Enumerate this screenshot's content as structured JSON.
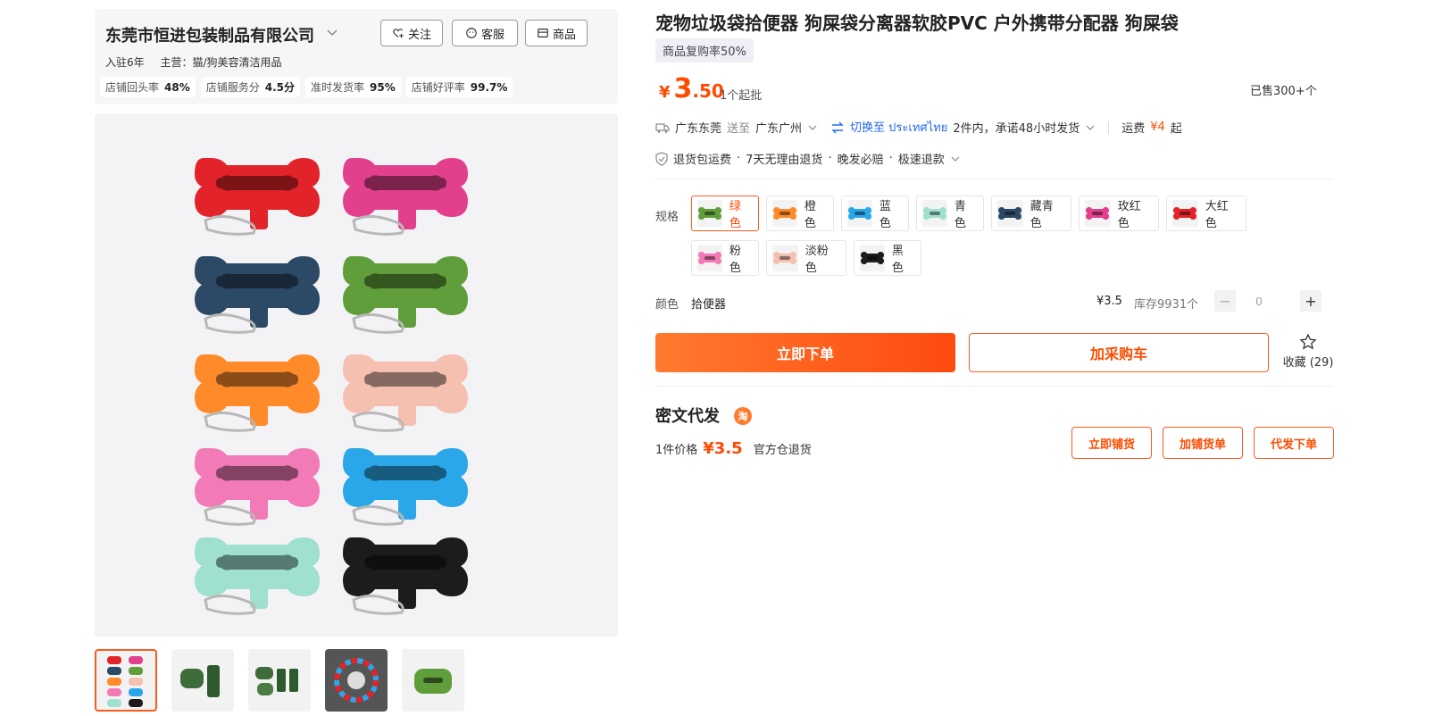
{
  "shop": {
    "name": "东莞市恒进包装制品有限公司",
    "follow_label": "关注",
    "service_label": "客服",
    "goods_label": "商品",
    "years": "入驻6年",
    "main_business": "主营：猫/狗美容清洁用品",
    "stats": [
      {
        "label": "店铺回头率",
        "value": "48%"
      },
      {
        "label": "店铺服务分",
        "value": "4.5分"
      },
      {
        "label": "准时发货率",
        "value": "95%"
      },
      {
        "label": "店铺好评率",
        "value": "99.7%"
      }
    ]
  },
  "product": {
    "title": "宠物垃圾袋拾便器 狗屎袋分离器软胶PVC 户外携带分配器 狗屎袋",
    "repurchase": "商品复购率50%",
    "price_currency": "¥",
    "price_int": "3",
    "price_dec": ".50",
    "min_order": "1个起批",
    "sold": "已售300+个"
  },
  "shipping": {
    "from": "广东东莞",
    "to_word": "送至",
    "to": "广东广州",
    "switch": "切换至 ประเทศไทย",
    "promise": "2件内，承诺48小时发货",
    "fee_label": "运费",
    "fee": "¥4",
    "fee_suffix": "起"
  },
  "services": [
    "退货包运费",
    "7天无理由退货",
    "晚发必赔",
    "极速退款"
  ],
  "spec": {
    "label": "规格",
    "options": [
      {
        "label": "绿色",
        "color": "#5f9e3a",
        "selected": true
      },
      {
        "label": "橙色",
        "color": "#ff8a2a",
        "selected": false
      },
      {
        "label": "蓝色",
        "color": "#2aa7e8",
        "selected": false
      },
      {
        "label": "青色",
        "color": "#9fe0cf",
        "selected": false
      },
      {
        "label": "藏青色",
        "color": "#2c4a66",
        "selected": false
      },
      {
        "label": "玫红色",
        "color": "#e2408c",
        "selected": false
      },
      {
        "label": "大红色",
        "color": "#e2232a",
        "selected": false
      },
      {
        "label": "粉色",
        "color": "#f27ab6",
        "selected": false
      },
      {
        "label": "淡粉色",
        "color": "#f5c0b0",
        "selected": false
      },
      {
        "label": "黑色",
        "color": "#1c1c1c",
        "selected": false
      }
    ]
  },
  "color_row": {
    "label": "颜色",
    "value": "拾便器",
    "price": "¥3.5",
    "stock": "库存9931个",
    "qty": "0"
  },
  "actions": {
    "buy_now": "立即下单",
    "add_cart": "加采购车",
    "favorite": "收藏 (29)"
  },
  "dropship": {
    "title": "密文代发",
    "badge": "淘",
    "price_label": "1件价格",
    "price": "¥3.5",
    "return_note": "官方仓退货",
    "btn_list": "立即铺货",
    "btn_add": "加铺货单",
    "btn_order": "代发下单"
  },
  "colors": {
    "accent": "#ff4a00",
    "link": "#2468f2"
  }
}
